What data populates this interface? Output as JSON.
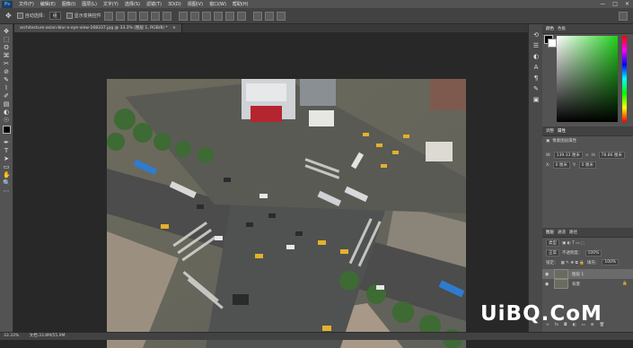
{
  "app": {
    "logo": "Ps"
  },
  "menu": [
    "文件(F)",
    "编辑(E)",
    "图像(I)",
    "图层(L)",
    "文字(Y)",
    "选择(S)",
    "滤镜(T)",
    "3D(D)",
    "视图(V)",
    "窗口(W)",
    "帮助(H)"
  ],
  "window_controls": [
    "—",
    "□",
    "✕"
  ],
  "options_bar": {
    "auto_select_label": "自动选择：",
    "auto_select_value": "组",
    "show_transform_label": "显示变换控件"
  },
  "document_tab": {
    "title": "architecture-asian-blur-x-eye-view-168337.jpg @ 33.3% (图层 1, RGB/8) *",
    "close": "×"
  },
  "tools": [
    "✥",
    "⬚",
    "ʘ",
    "⌘",
    "✂",
    "⊘",
    "✎",
    "⌇",
    "✐",
    "▤",
    "◐",
    "☉",
    "✒",
    "T",
    "➤",
    "▭",
    "✋",
    "🔍",
    "⋯"
  ],
  "color_panel": {
    "tabs": [
      "颜色",
      "色板"
    ],
    "colors": {
      "fg": "#000000",
      "bg": "#ffffff",
      "hue_selected": "#22d11e"
    }
  },
  "properties_panel": {
    "tabs": [
      "调整",
      "属性"
    ],
    "title": "像素图层属性",
    "w_label": "W:",
    "w_value": "139.33 厘米",
    "h_label": "H:",
    "h_value": "78.86 厘米",
    "x_label": "X:",
    "x_value": "0 厘米",
    "y_label": "Y:",
    "y_value": "0 厘米"
  },
  "layers_panel": {
    "tabs": [
      "图层",
      "通道",
      "路径"
    ],
    "kind_label": "类型",
    "blend_mode": "正常",
    "opacity_label": "不透明度：",
    "opacity_value": "100%",
    "lock_label": "锁定：",
    "fill_label": "填充：",
    "fill_value": "100%",
    "layers": [
      {
        "name": "图层 1",
        "selected": true
      },
      {
        "name": "背景",
        "selected": false
      }
    ]
  },
  "status_bar": {
    "zoom": "33.33%",
    "doc_size": "文档:33.8M/55.9M"
  },
  "watermark": "UiBQ.CoM"
}
